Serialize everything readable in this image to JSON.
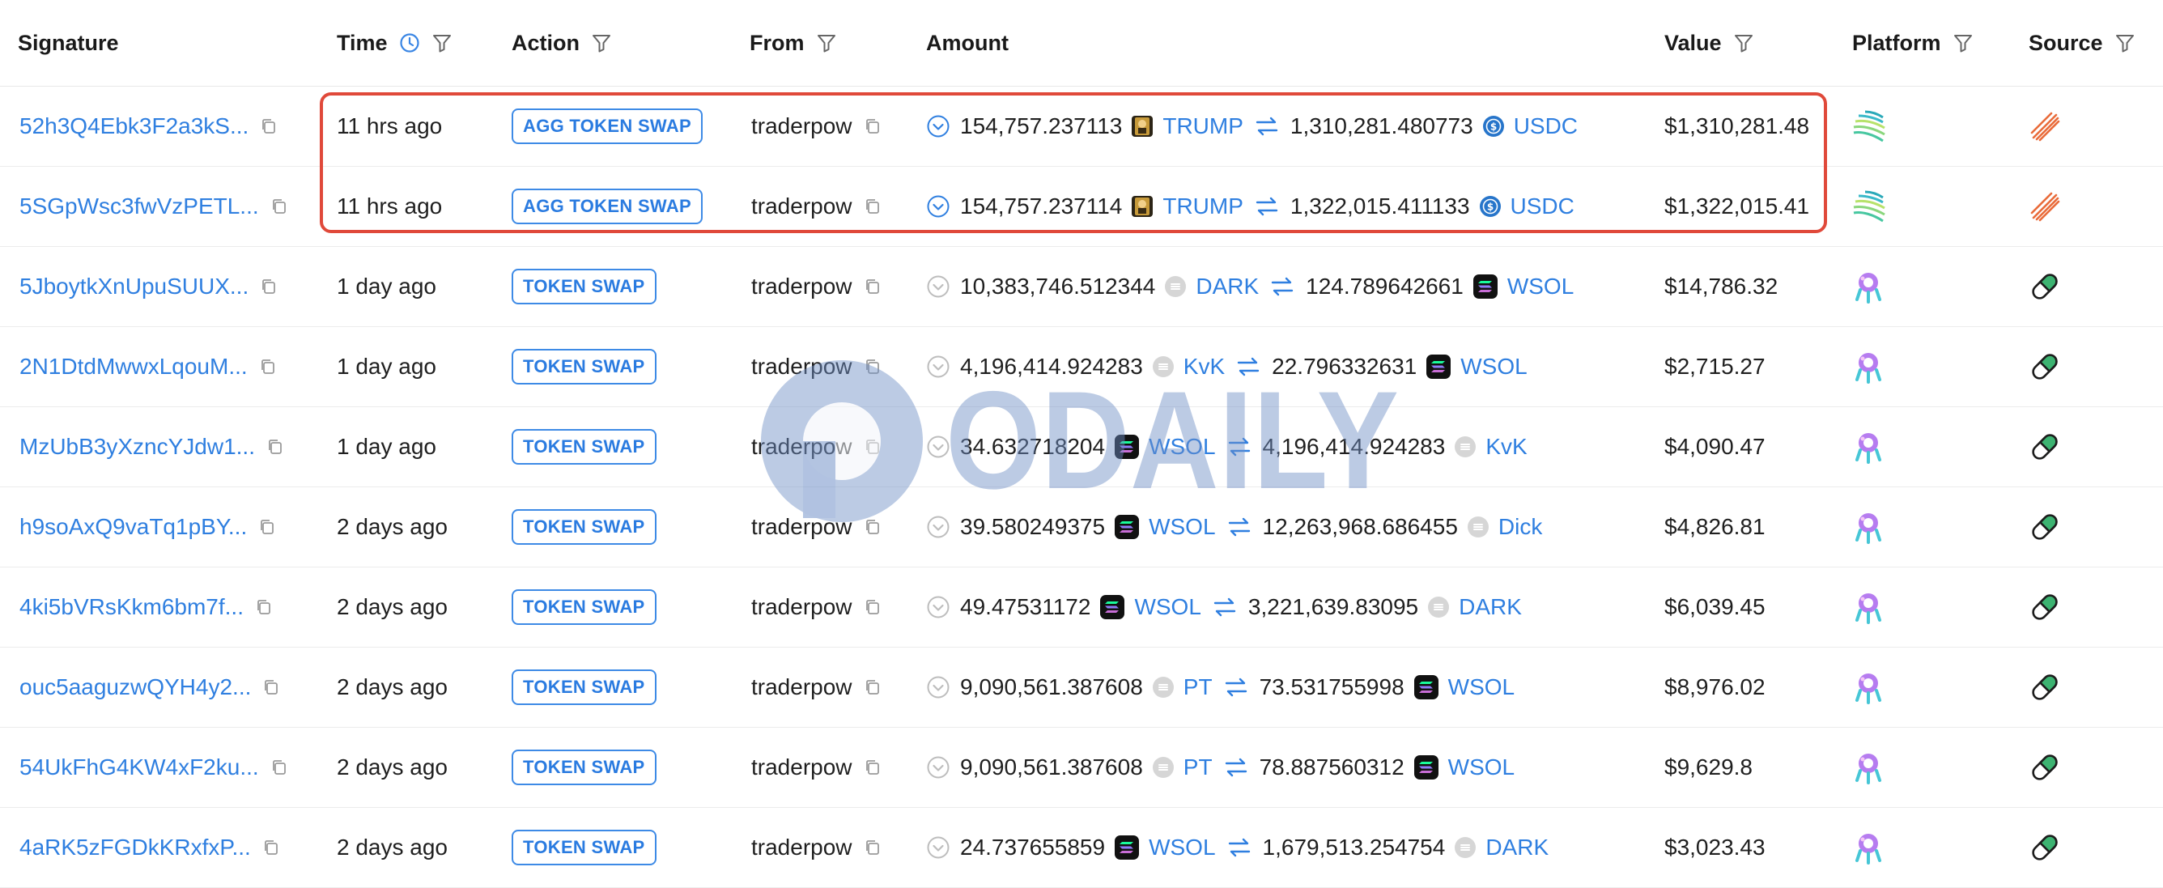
{
  "columns": {
    "signature": "Signature",
    "time": "Time",
    "action": "Action",
    "from": "From",
    "amount": "Amount",
    "value": "Value",
    "platform": "Platform",
    "source": "Source"
  },
  "header_icons": {
    "time": [
      "clock-icon",
      "filter-icon"
    ],
    "action": "filter-icon",
    "from": "filter-icon",
    "value": "filter-icon",
    "platform": "filter-icon",
    "source": "filter-icon"
  },
  "colors": {
    "accent": "#2f7fe0",
    "highlight": "#e0493a",
    "watermark": "#6f8fc6"
  },
  "watermark": {
    "text": "ODAILY"
  },
  "rows": [
    {
      "signature": "52h3Q4Ebk3F2a3kS...",
      "time": "11 hrs ago",
      "action": "AGG TOKEN SWAP",
      "from": "traderpow",
      "amount_in": "154,757.237113",
      "token_in": "TRUMP",
      "amount_out": "1,310,281.480773",
      "token_out": "USDC",
      "value": "$1,310,281.48",
      "platform": "jupiter-icon",
      "source": "jupiter-source-icon",
      "highlighted": true
    },
    {
      "signature": "5SGpWsc3fwVzPETL...",
      "time": "11 hrs ago",
      "action": "AGG TOKEN SWAP",
      "from": "traderpow",
      "amount_in": "154,757.237114",
      "token_in": "TRUMP",
      "amount_out": "1,322,015.411133",
      "token_out": "USDC",
      "value": "$1,322,015.41",
      "platform": "jupiter-icon",
      "source": "jupiter-source-icon",
      "highlighted": true
    },
    {
      "signature": "5JboytkXnUpuSUUX...",
      "time": "1 day ago",
      "action": "TOKEN SWAP",
      "from": "traderpow",
      "amount_in": "10,383,746.512344",
      "token_in": "DARK",
      "amount_out": "124.789642661",
      "token_out": "WSOL",
      "value": "$14,786.32",
      "platform": "raydium-icon",
      "source": "pill-icon"
    },
    {
      "signature": "2N1DtdMwwxLqouM...",
      "time": "1 day ago",
      "action": "TOKEN SWAP",
      "from": "traderpow",
      "amount_in": "4,196,414.924283",
      "token_in": "KvK",
      "amount_out": "22.796332631",
      "token_out": "WSOL",
      "value": "$2,715.27",
      "platform": "raydium-icon",
      "source": "pill-icon"
    },
    {
      "signature": "MzUbB3yXzncYJdw1...",
      "time": "1 day ago",
      "action": "TOKEN SWAP",
      "from": "traderpow",
      "amount_in": "34.632718204",
      "token_in": "WSOL",
      "amount_out": "4,196,414.924283",
      "token_out": "KvK",
      "value": "$4,090.47",
      "platform": "raydium-icon",
      "source": "pill-icon"
    },
    {
      "signature": "h9soAxQ9vaTq1pBY...",
      "time": "2 days ago",
      "action": "TOKEN SWAP",
      "from": "traderpow",
      "amount_in": "39.580249375",
      "token_in": "WSOL",
      "amount_out": "12,263,968.686455",
      "token_out": "Dick",
      "value": "$4,826.81",
      "platform": "raydium-icon",
      "source": "pill-icon"
    },
    {
      "signature": "4ki5bVRsKkm6bm7f...",
      "time": "2 days ago",
      "action": "TOKEN SWAP",
      "from": "traderpow",
      "amount_in": "49.47531172",
      "token_in": "WSOL",
      "amount_out": "3,221,639.83095",
      "token_out": "DARK",
      "value": "$6,039.45",
      "platform": "raydium-icon",
      "source": "pill-icon"
    },
    {
      "signature": "ouc5aaguzwQYH4y2...",
      "time": "2 days ago",
      "action": "TOKEN SWAP",
      "from": "traderpow",
      "amount_in": "9,090,561.387608",
      "token_in": "PT",
      "amount_out": "73.531755998",
      "token_out": "WSOL",
      "value": "$8,976.02",
      "platform": "raydium-icon",
      "source": "pill-icon"
    },
    {
      "signature": "54UkFhG4KW4xF2ku...",
      "time": "2 days ago",
      "action": "TOKEN SWAP",
      "from": "traderpow",
      "amount_in": "9,090,561.387608",
      "token_in": "PT",
      "amount_out": "78.887560312",
      "token_out": "WSOL",
      "value": "$9,629.8",
      "platform": "raydium-icon",
      "source": "pill-icon"
    },
    {
      "signature": "4aRK5zFGDkKRxfxP...",
      "time": "2 days ago",
      "action": "TOKEN SWAP",
      "from": "traderpow",
      "amount_in": "24.737655859",
      "token_in": "WSOL",
      "amount_out": "1,679,513.254754",
      "token_out": "DARK",
      "value": "$3,023.43",
      "platform": "raydium-icon",
      "source": "pill-icon"
    }
  ]
}
